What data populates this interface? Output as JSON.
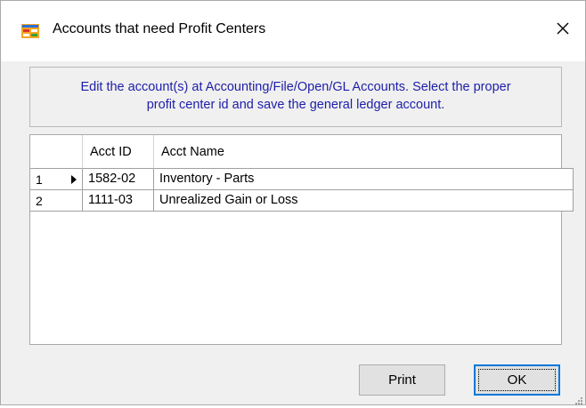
{
  "window": {
    "title": "Accounts that need Profit Centers",
    "icon": "form-icon",
    "close_icon": "close-icon"
  },
  "message": {
    "line1": "Edit the account(s) at Accounting/File/Open/GL Accounts. Select the proper",
    "line2": "profit center id and save the general ledger account.",
    "color": "#1e1ea8"
  },
  "grid": {
    "columns": [
      "Acct ID",
      "Acct Name"
    ],
    "rows": [
      {
        "num": "1",
        "acct_id": "1582-02",
        "acct_name": "Inventory - Parts",
        "current": true
      },
      {
        "num": "2",
        "acct_id": "1111-03",
        "acct_name": "Unrealized Gain or Loss",
        "current": false
      }
    ]
  },
  "buttons": {
    "print": "Print",
    "ok": "OK",
    "focus_color": "#0078d7"
  }
}
